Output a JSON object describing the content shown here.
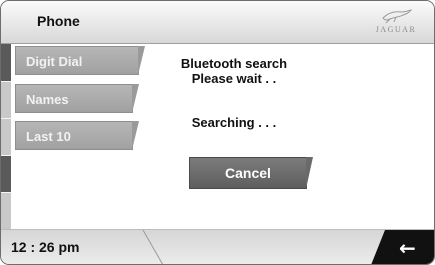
{
  "header": {
    "title": "Phone",
    "logo": {
      "text": "JAGUAR",
      "icon": "leaping-jaguar-icon"
    }
  },
  "nav": {
    "items": [
      {
        "label": "Digit Dial",
        "active": true
      },
      {
        "label": "Names",
        "active": false
      },
      {
        "label": "Last 10",
        "active": false
      }
    ]
  },
  "status": {
    "line1": "Bluetooth search",
    "line2": "Please wait . .",
    "line3": "Searching . . ."
  },
  "cancel_label": "Cancel",
  "footer": {
    "time": "12 : 26 pm",
    "back_icon": "←"
  },
  "colors": {
    "button": "#a9a9a9",
    "button_dark": "#666666",
    "back_button": "#111111"
  }
}
